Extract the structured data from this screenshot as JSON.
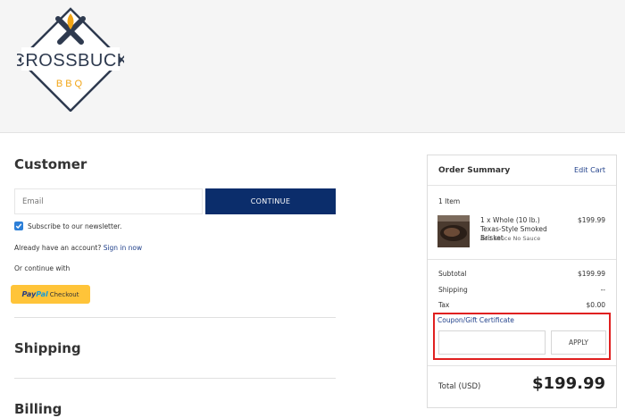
{
  "header": {
    "logo_text": "CROSSBUCK",
    "logo_subtext": "BBQ"
  },
  "customer": {
    "title": "Customer",
    "email_placeholder": "Email",
    "continue_label": "CONTINUE",
    "newsletter_label": "Subscribe to our newsletter.",
    "account_prompt": "Already have an account?",
    "sign_in_link": "Sign in now",
    "or_continue": "Or continue with",
    "paypal": {
      "pay": "Pay",
      "pal": "Pal",
      "checkout": "Checkout"
    }
  },
  "shipping": {
    "title": "Shipping"
  },
  "billing": {
    "title": "Billing"
  },
  "summary": {
    "title": "Order Summary",
    "edit_cart": "Edit Cart",
    "item_count": "1 Item",
    "item": {
      "name": "1 x Whole (10 lb.) Texas-Style Smoked Brisket",
      "option": "Add Sauce No Sauce",
      "price": "$199.99"
    },
    "subtotal_label": "Subtotal",
    "subtotal_value": "$199.99",
    "shipping_label": "Shipping",
    "shipping_value": "--",
    "tax_label": "Tax",
    "tax_value": "$0.00",
    "coupon_label": "Coupon/Gift Certificate",
    "apply_label": "APPLY",
    "total_label": "Total (USD)",
    "total_value": "$199.99"
  },
  "colors": {
    "primary_button": "#0b2d6b",
    "link": "#1f3f8a",
    "paypal_yellow": "#ffc439",
    "highlight_border": "#e02020",
    "logo_navy": "#2e3a4f",
    "logo_gold": "#f2a516"
  }
}
